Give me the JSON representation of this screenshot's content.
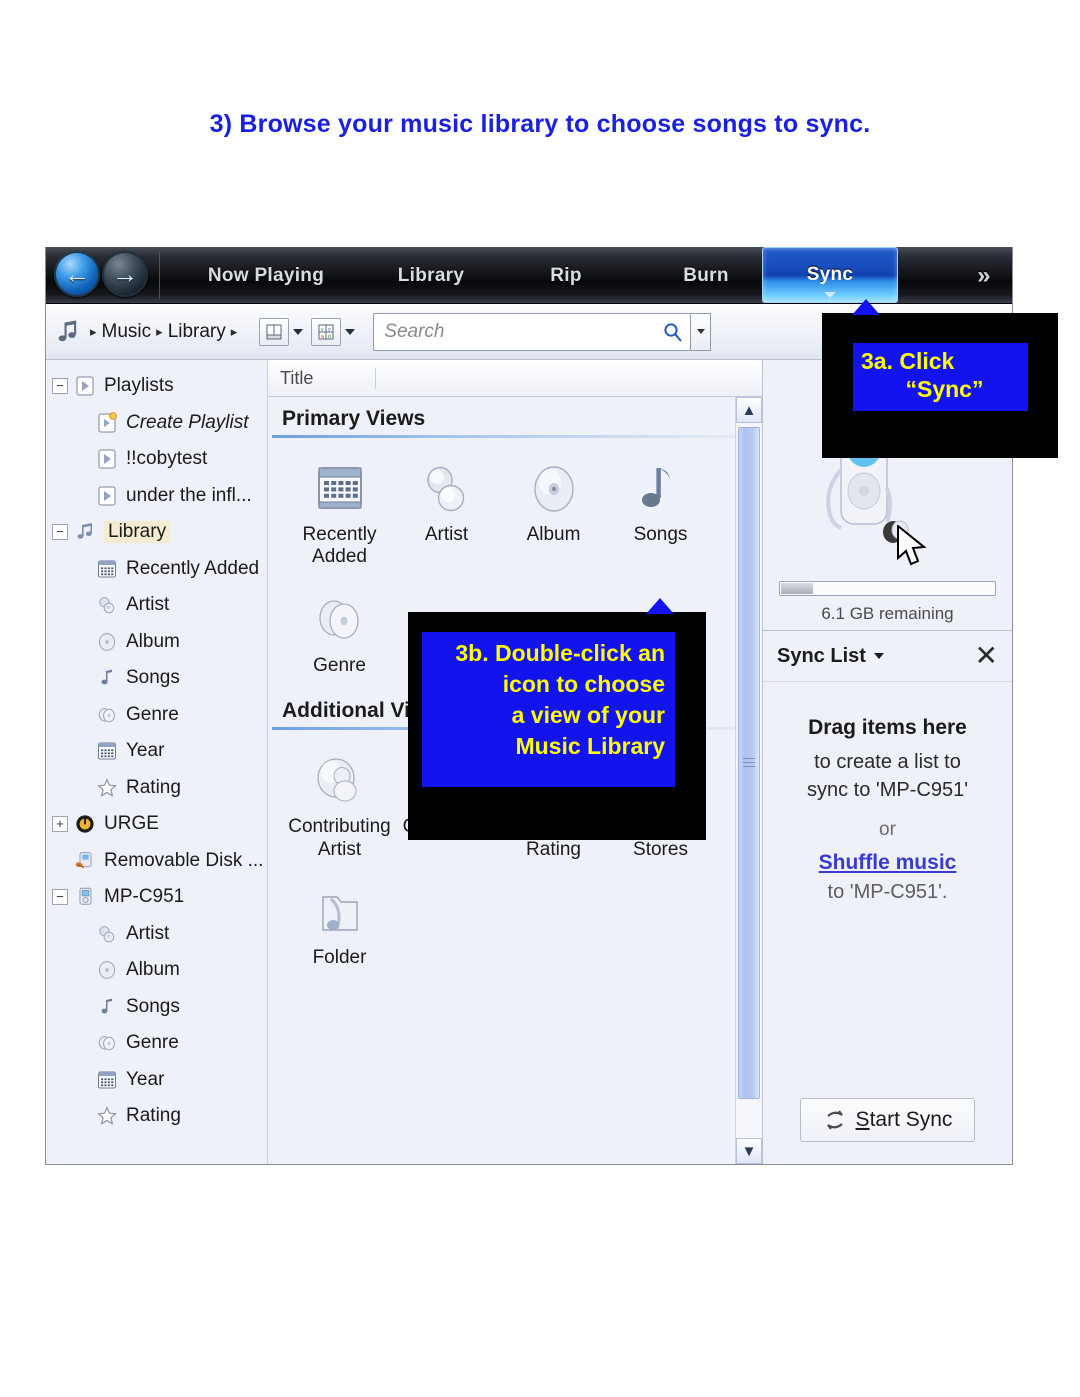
{
  "heading": "3) Browse your music library to choose songs to sync.",
  "topbar": {
    "back_icon": "back-arrow-icon",
    "forward_icon": "forward-arrow-icon",
    "tabs": [
      {
        "label": "Now Playing"
      },
      {
        "label": "Library"
      },
      {
        "label": "Rip"
      },
      {
        "label": "Burn"
      },
      {
        "label": "Sync"
      }
    ],
    "overflow_label": "»"
  },
  "addressbar": {
    "music_icon": "music-note-icon",
    "crumb1": "Music",
    "crumb2": "Library",
    "sep": "▸",
    "layout_button": "layout-icon",
    "viewoptions_button": "view-options-icon",
    "search_placeholder": "Search",
    "search_value": "",
    "search_icon": "magnifier-icon"
  },
  "tree": {
    "items": [
      {
        "label": "Playlists",
        "expander": "−",
        "indent": 0,
        "icon": "playlist-icon",
        "italic": false,
        "selected": false
      },
      {
        "label": "Create Playlist",
        "expander": "",
        "indent": 1,
        "icon": "create-playlist-icon",
        "italic": true,
        "selected": false
      },
      {
        "label": "!!cobytest",
        "expander": "",
        "indent": 1,
        "icon": "playlist-icon",
        "italic": false,
        "selected": false
      },
      {
        "label": "under the infl...",
        "expander": "",
        "indent": 1,
        "icon": "playlist-icon",
        "italic": false,
        "selected": false
      },
      {
        "label": "Library",
        "expander": "−",
        "indent": 0,
        "icon": "library-music-icon",
        "italic": false,
        "selected": true
      },
      {
        "label": "Recently Added",
        "expander": "",
        "indent": 1,
        "icon": "recently-added-icon",
        "italic": false,
        "selected": false
      },
      {
        "label": "Artist",
        "expander": "",
        "indent": 1,
        "icon": "artist-icon",
        "italic": false,
        "selected": false
      },
      {
        "label": "Album",
        "expander": "",
        "indent": 1,
        "icon": "album-icon",
        "italic": false,
        "selected": false
      },
      {
        "label": "Songs",
        "expander": "",
        "indent": 1,
        "icon": "songs-icon",
        "italic": false,
        "selected": false
      },
      {
        "label": "Genre",
        "expander": "",
        "indent": 1,
        "icon": "genre-icon",
        "italic": false,
        "selected": false
      },
      {
        "label": "Year",
        "expander": "",
        "indent": 1,
        "icon": "year-icon",
        "italic": false,
        "selected": false
      },
      {
        "label": "Rating",
        "expander": "",
        "indent": 1,
        "icon": "rating-star-icon",
        "italic": false,
        "selected": false
      },
      {
        "label": "URGE",
        "expander": "+",
        "indent": 0,
        "icon": "urge-icon",
        "italic": false,
        "selected": false
      },
      {
        "label": "Removable Disk ...",
        "expander": "",
        "indent": 0,
        "icon": "removable-disk-icon",
        "italic": false,
        "selected": false
      },
      {
        "label": "MP-C951",
        "expander": "−",
        "indent": 0,
        "icon": "device-icon",
        "italic": false,
        "selected": false
      },
      {
        "label": "Artist",
        "expander": "",
        "indent": 1,
        "icon": "artist-icon",
        "italic": false,
        "selected": false
      },
      {
        "label": "Album",
        "expander": "",
        "indent": 1,
        "icon": "album-icon",
        "italic": false,
        "selected": false
      },
      {
        "label": "Songs",
        "expander": "",
        "indent": 1,
        "icon": "songs-icon",
        "italic": false,
        "selected": false
      },
      {
        "label": "Genre",
        "expander": "",
        "indent": 1,
        "icon": "genre-icon",
        "italic": false,
        "selected": false
      },
      {
        "label": "Year",
        "expander": "",
        "indent": 1,
        "icon": "year-icon",
        "italic": false,
        "selected": false
      },
      {
        "label": "Rating",
        "expander": "",
        "indent": 1,
        "icon": "rating-star-icon",
        "italic": false,
        "selected": false
      }
    ]
  },
  "center": {
    "column_headers": [
      "Title",
      ""
    ],
    "primary_section": "Primary Views",
    "primary_row1": [
      {
        "caption": "Recently\nAdded",
        "icon": "recently-added-icon"
      },
      {
        "caption": "Artist",
        "icon": "artist-icon"
      },
      {
        "caption": "Album",
        "icon": "album-icon"
      },
      {
        "caption": "Songs",
        "icon": "songs-note-icon"
      }
    ],
    "primary_row2": [
      {
        "caption": "Genre",
        "icon": "genre-icon"
      }
    ],
    "additional_section": "Additional Views",
    "additional_row1": [
      {
        "caption": "Contributing\nArtist",
        "icon": "contributing-artist-icon"
      },
      {
        "caption": "Composer",
        "icon": "composer-icon"
      },
      {
        "caption": "Parental\nRating",
        "icon": "parental-rating-lock-icon"
      },
      {
        "caption": "Online\nStores",
        "icon": "online-stores-icon"
      }
    ],
    "additional_row2": [
      {
        "caption": "Folder",
        "icon": "folder-icon"
      }
    ]
  },
  "rightpane": {
    "device_icon": "mp3-player-device-image",
    "capacity_text": "6.1 GB remaining",
    "capacity_fill_percent": 15,
    "sync_list_label": "Sync List",
    "close_icon": "close-x-icon",
    "drop_title": "Drag items here",
    "drop_line2": "to create a list to",
    "drop_line3": "sync to 'MP-C951'",
    "drop_or": "or",
    "drop_link": "Shuffle music",
    "drop_line4": "to 'MP-C951'.",
    "start_sync_icon": "sync-refresh-icon",
    "start_sync_label_u": "S",
    "start_sync_label_rest": "tart Sync"
  },
  "callouts": {
    "a": {
      "line1": "3a. Click",
      "line2": "“Sync”"
    },
    "b": {
      "line1": "3b.  Double-click an",
      "line2": "icon  to  choose",
      "line3": "a view of your",
      "line4": "Music    Library"
    }
  },
  "colors": {
    "heading": "#1a20e0",
    "callout_bg": "#000000",
    "callout_inner": "#1313f0",
    "callout_text": "#ffff00",
    "sync_tab": "#1848b8",
    "link": "#3a3ad0"
  }
}
